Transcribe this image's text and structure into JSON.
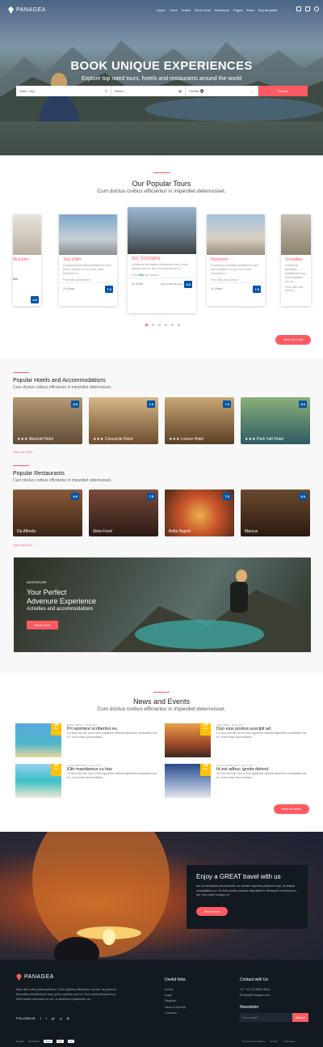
{
  "header": {
    "brand": "PANAGEA",
    "nav": [
      "Home",
      "Tours",
      "Hotels",
      "Eat & Drink",
      "Adventure",
      "Pages",
      "Extra",
      "Buy template"
    ]
  },
  "hero": {
    "title": "BOOK UNIQUE EXPERIENCES",
    "subtitle": "Explore top rated tours, hotels and restaurants around the world",
    "search": {
      "city_placeholder": "Hotel, City...",
      "when_placeholder": "When...",
      "guests_label": "Guests",
      "guests_count": "1",
      "button": "Search"
    }
  },
  "tours": {
    "title": "Our Popular Tours",
    "subtitle": "Cum doctus civibus efficiantur in imperdiet deterruisset.",
    "button": "View all Tours",
    "cards": [
      {
        "name": "Mussum",
        "price": "$34"
      },
      {
        "name": "Tour Eiffel",
        "tag": "Historic",
        "text": "Id placerat tacimates definitionem sea, prima quidam vim no. Duo nobis persecuti cu.",
        "price": "From $54 /per person",
        "dur": "1h 30min",
        "rating": "7.0",
        "reviews": "Superb 350 Reviews"
      },
      {
        "name": "Arc Triomphe",
        "tag": "Historic",
        "text": "Id placerat tacimates definitionem sea, prima quidam vim no. Duo nobis persecuti cu.",
        "price_pre": "From",
        "price_val": "$54",
        "price_post": "/per person",
        "dur": "1h 30min",
        "rating": "8.9",
        "reviews": "Superb 350 Reviews"
      },
      {
        "name": "Notredam",
        "tag": "Historic",
        "text": "Id placerat tacimates definitionem sea, prima quidam vim no. Duo nobis persecuti cu.",
        "price": "From $54 /per person",
        "dur": "1h 30min",
        "rating": "7.5",
        "reviews": "Superb 350 Reviews"
      },
      {
        "name": "Versailles",
        "text": "Id placerat tacimates definitionem sea, prima quidam vim no.",
        "price": "From $54 /per person"
      }
    ]
  },
  "hotels": {
    "title": "Popular Hotels and Accommodations",
    "subtitle": "Cum doctus civibus efficiantur in imperdiet deterruisset.",
    "view_all": "View all (157)",
    "items": [
      {
        "name": "Marriott Hotel",
        "score": "8.9"
      },
      {
        "name": "Concorde Hotel",
        "score": "7.0"
      },
      {
        "name": "Louvre Hotel",
        "score": "7.0"
      },
      {
        "name": "Park Yatt Hotel",
        "score": "8.9"
      }
    ]
  },
  "restaurants": {
    "title": "Popular Restaurants",
    "subtitle": "Cum doctus civibus efficiantur in imperdiet deterruisset.",
    "view_all": "View all (157)",
    "items": [
      {
        "name": "Da Alfredo",
        "score": "8.9"
      },
      {
        "name": "Slow Food",
        "score": "7.5"
      },
      {
        "name": "Bella Napoli",
        "score": "7.5"
      },
      {
        "name": "Marcus",
        "score": "8.9"
      }
    ]
  },
  "adventure": {
    "tag": "ADVENTURE",
    "title_1": "Your Perfect",
    "title_2": "Advenure Experience",
    "sub": "Activities and accommodations",
    "button": "Read more"
  },
  "news": {
    "title": "News and Events",
    "subtitle": "Cum doctus civibus efficiantur in imperdiet deterruisset.",
    "button": "View all news",
    "items": [
      {
        "day": "28",
        "month": "Dec",
        "meta": "MARK TWAIN – 20.11.2017",
        "title": "Pri oportere scribentur eu",
        "text": "Cu eum alia elit, usu in eius appareat, deleniti sapientem honestatis eos ex. In ius esse ullum vidisse...."
      },
      {
        "day": "28",
        "month": "Dec",
        "meta": "JHON DOE – 20.11.2017",
        "title": "Duo eius postea suscipit ad",
        "text": "Cu eum alia elit, usu in eius appareat, deleniti sapientem honestatis eos ex. In ius esse ullum vidisse...."
      },
      {
        "day": "28",
        "month": "Dec",
        "meta": "LUCA ROBINSON – 20.11.2017",
        "title": "Elitr mandamus cu has",
        "text": "Cu eum alia elit, usu in eius appareat, deleniti sapientem honestatis eos ex. In ius esse ullum vidisse...."
      },
      {
        "day": "28",
        "month": "Dec",
        "meta": "PAULA RODRIGUEZ – 20.11.2017",
        "title": "Id est adhuc ignota delenit",
        "text": "Cu eum alia elit, usu in eius appareat, deleniti sapientem honestatis eos ex. In ius esse ullum vidisse...."
      }
    ]
  },
  "promo": {
    "title": "Enjoy a GREAT travel with us",
    "text": "Ius cu tamquam persequeris, eu veniam apeirian platonem qui, id aliquip voluptatibus pri. Ei mea primis ornatus disputationi. Menandri erroribus cu per, duo solet congue ut.",
    "button": "Read more"
  },
  "footer": {
    "brand": "PANAGEA",
    "about": "Mea nibh meis philosophia eu. Duis legimus efficiantur ea sea. Id placerat tacimates definitionem sea, prima quidam vim no. Duo nobis persecuti cu. Nihil facilisi indoctum an vix, ut delectus expetendis vis.",
    "follow": "FOLLOW US",
    "useful_title": "Useful links",
    "links": [
      "About",
      "Login",
      "Register",
      "News & Events",
      "Contacts"
    ],
    "contact_title": "Contact with Us",
    "phone": "+ 61 23 8093 3400",
    "email": "info@Panagea.com",
    "newsletter_title": "Newsletter",
    "email_placeholder": "Your email",
    "submit": "Submit",
    "lang": "English",
    "currency": "US Dollars",
    "terms": "Terms and conditions",
    "privacy": "Privacy",
    "copyright": "© Panagea"
  },
  "colors": {
    "accent": "#fc5b62",
    "score": "#0054a6",
    "date": "#ffc107",
    "footer": "#121921"
  }
}
